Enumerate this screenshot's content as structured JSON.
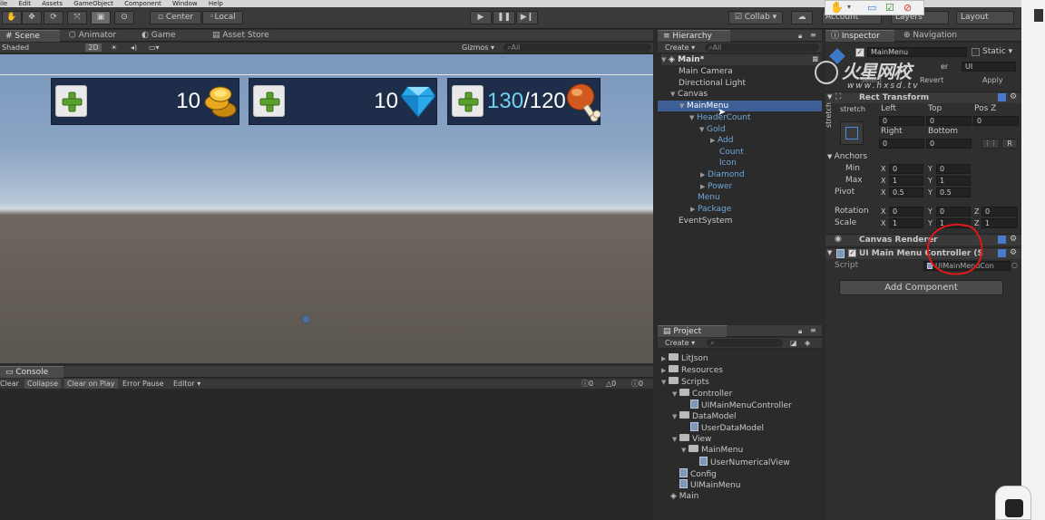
{
  "menu_bar": [
    "ile",
    "Edit",
    "Assets",
    "GameObject",
    "Component",
    "Window",
    "Help"
  ],
  "toolbar": {
    "pivot_label": "Center",
    "space_label": "Local",
    "collab_label": "Collab ▾",
    "account_label": "Account",
    "layers_label": "Layers",
    "layout_label": "Layout"
  },
  "scene_tabs": {
    "scene": "Scene",
    "animator": "Animator",
    "game": "Game",
    "asset_store": "Asset Store"
  },
  "scene_bar": {
    "shading": "Shaded",
    "mode_2d": "2D",
    "gizmos": "Gizmos ▾",
    "search_placeholder": "All"
  },
  "resources": {
    "gold": "10",
    "diamond": "10",
    "power_current": "130",
    "power_sep_max": "/120"
  },
  "hierarchy": {
    "tab": "Hierarchy",
    "create": "Create ▾",
    "search_placeholder": "All",
    "scene_name": "Main*",
    "items": {
      "main_camera": "Main Camera",
      "directional_light": "Directional Light",
      "canvas": "Canvas",
      "main_menu": "MainMenu",
      "header_count": "HeaderCount",
      "gold": "Gold",
      "add": "Add",
      "count": "Count",
      "icon": "Icon",
      "diamond": "Diamond",
      "power": "Power",
      "menu": "Menu",
      "package": "Package",
      "event_system": "EventSystem"
    }
  },
  "project": {
    "tab": "Project",
    "create": "Create ▾",
    "items": {
      "litjson": "LitJson",
      "resources": "Resources",
      "scripts": "Scripts",
      "controller": "Controller",
      "ui_main_menu_controller": "UIMainMenuController",
      "data_model": "DataModel",
      "user_data_model": "UserDataModel",
      "view": "View",
      "view_main_menu": "MainMenu",
      "user_numerical_view": "UserNumericalView",
      "config": "Config",
      "ui_main_menu": "UIMainMenu",
      "main": "Main"
    }
  },
  "console": {
    "tab": "Console",
    "clear": "Clear",
    "collapse": "Collapse",
    "clear_on_play": "Clear on Play",
    "error_pause": "Error Pause",
    "editor": "Editor ▾",
    "count_info": "0",
    "count_warn": "0",
    "count_error": "0"
  },
  "inspector": {
    "tab": "Inspector",
    "navigation_tab": "Navigation",
    "object_name": "MainMenu",
    "static_label": "Static ▾",
    "tag_fragment": "er",
    "layer_value": "UI",
    "prefab_select": "Select",
    "prefab_revert": "Revert",
    "prefab_apply": "Apply",
    "rect_transform": {
      "title": "Rect Transform",
      "stretch_label": "stretch",
      "left_label": "Left",
      "top_label": "Top",
      "posz_label": "Pos Z",
      "left": "0",
      "top": "0",
      "posz": "0",
      "right_label": "Right",
      "bottom_label": "Bottom",
      "right": "0",
      "bottom": "0",
      "r_label": "R",
      "anchors_label": "Anchors",
      "min_label": "Min",
      "max_label": "Max",
      "pivot_label": "Pivot",
      "x_label": "X",
      "y_label": "Y",
      "z_label": "Z",
      "min_x": "0",
      "min_y": "0",
      "max_x": "1",
      "max_y": "1",
      "pivot_x": "0.5",
      "pivot_y": "0.5",
      "rotation_label": "Rotation",
      "rot_x": "0",
      "rot_y": "0",
      "rot_z": "0",
      "scale_label": "Scale",
      "scale_x": "1",
      "scale_y": "1",
      "scale_z": "1"
    },
    "canvas_renderer": "Canvas Renderer",
    "script_component": "UI Main Menu Controller (S",
    "script_label": "Script",
    "script_value": "UIMainMenuCon",
    "add_component": "Add Component"
  },
  "watermark": {
    "brand": "火星网校",
    "url": "www.hxsd.tv"
  },
  "colors": {
    "selection": "#3e5f96",
    "annotation_red": "#e01818",
    "accent_blue": "#6fa8dc",
    "panel_navy": "#1e2e4a"
  }
}
